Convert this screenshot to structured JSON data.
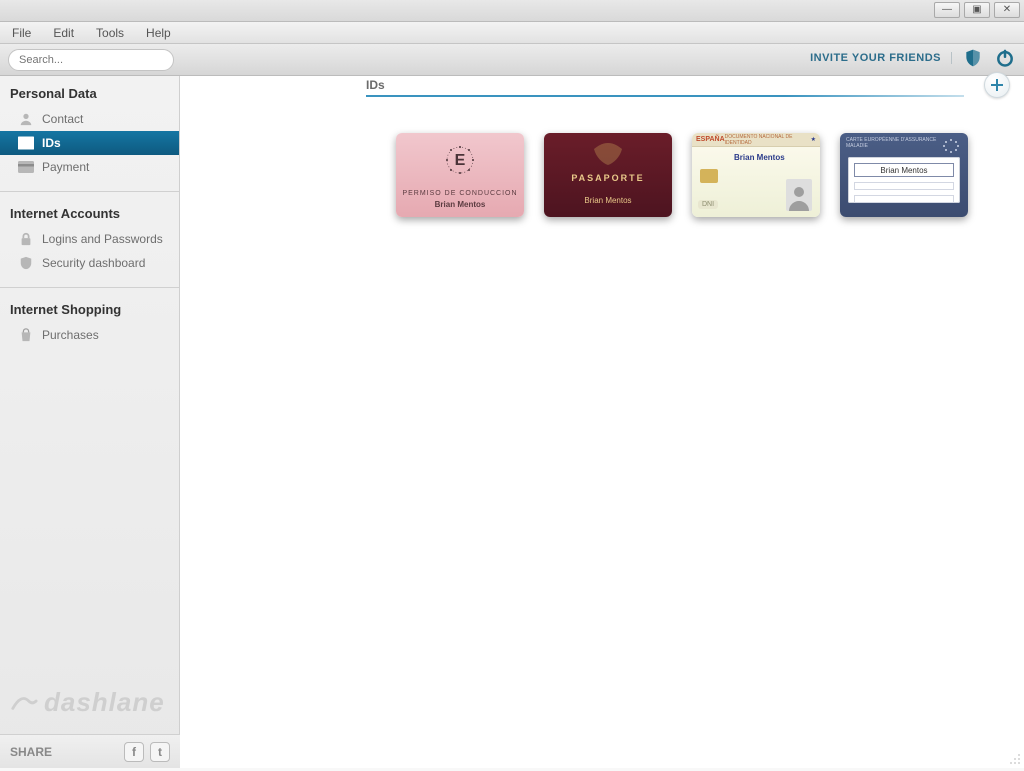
{
  "menu": {
    "file": "File",
    "edit": "Edit",
    "tools": "Tools",
    "help": "Help"
  },
  "window_controls": {
    "min": "—",
    "max": "▣",
    "close": "✕"
  },
  "search": {
    "placeholder": "Search..."
  },
  "header": {
    "invite": "INVITE YOUR FRIENDS"
  },
  "sidebar": {
    "section1": {
      "title": "Personal Data",
      "items": [
        {
          "label": "Contact"
        },
        {
          "label": "IDs"
        },
        {
          "label": "Payment"
        }
      ]
    },
    "section2": {
      "title": "Internet Accounts",
      "items": [
        {
          "label": "Logins and Passwords"
        },
        {
          "label": "Security dashboard"
        }
      ]
    },
    "section3": {
      "title": "Internet Shopping",
      "items": [
        {
          "label": "Purchases"
        }
      ]
    },
    "brand": "dashlane",
    "share_label": "SHARE",
    "share_fb": "f",
    "share_tw": "t"
  },
  "main": {
    "title": "IDs",
    "cards": {
      "driver": {
        "line1": "PERMISO DE CONDUCCION",
        "holder": "Brian Mentos"
      },
      "passport": {
        "line1": "PASAPORTE",
        "holder": "Brian Mentos"
      },
      "idcard": {
        "country": "ESPAÑA",
        "strip": "DOCUMENTO NACIONAL DE IDENTIDAD",
        "holder": "Brian Mentos",
        "dni": "DNI"
      },
      "ssn": {
        "hdr": "CARTE EUROPÉENNE D'ASSURANCE MALADIE",
        "holder": "Brian Mentos"
      }
    }
  }
}
